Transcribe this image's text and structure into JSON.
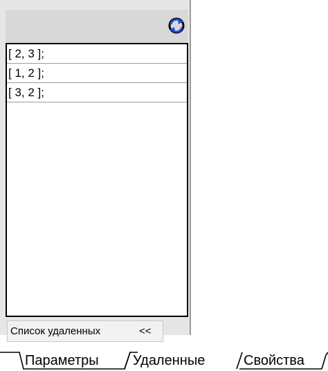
{
  "panel": {
    "refresh_icon": "refresh-icon",
    "items": [
      {
        "text": "[ 2, 3 ];"
      },
      {
        "text": "[ 1, 2 ];"
      },
      {
        "text": "[ 3, 2 ];"
      }
    ],
    "footer": {
      "label": "Список удаленных",
      "chevron": "<<"
    }
  },
  "tabs": [
    {
      "label": "Параметры"
    },
    {
      "label": "Удаленные",
      "active": true
    },
    {
      "label": "Свойства"
    }
  ],
  "colors": {
    "panel_bg": "#e6e6e6",
    "toolbar_bg": "#d8d8d8",
    "refresh_blue": "#1f4fd8"
  }
}
